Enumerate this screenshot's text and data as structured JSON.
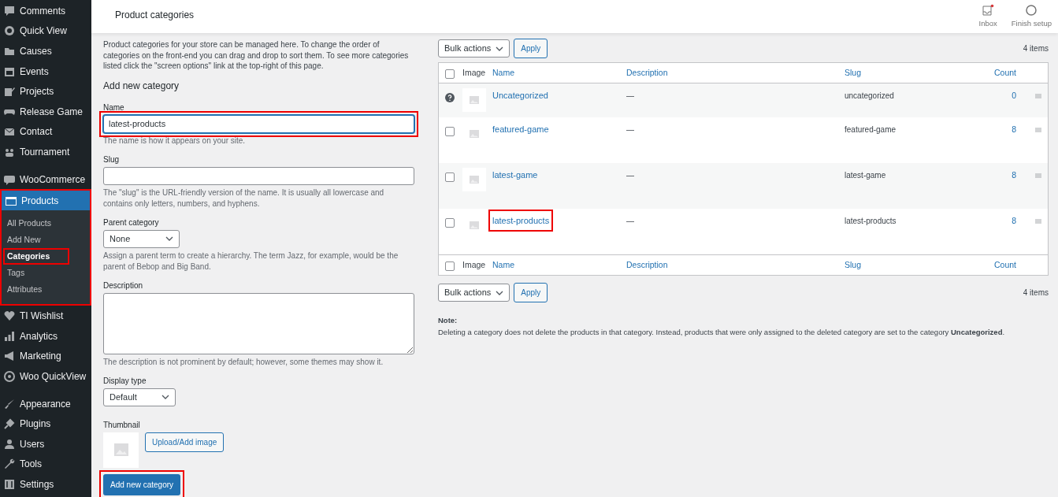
{
  "sidebar": {
    "groups": [
      {
        "items": [
          {
            "label": "Comments",
            "active": false
          },
          {
            "label": "Quick View",
            "active": false
          },
          {
            "label": "Causes",
            "active": false
          },
          {
            "label": "Events",
            "active": false
          },
          {
            "label": "Projects",
            "active": false
          },
          {
            "label": "Release Game",
            "active": false
          },
          {
            "label": "Contact",
            "active": false
          },
          {
            "label": "Tournament",
            "active": false
          }
        ]
      },
      {
        "items": [
          {
            "label": "WooCommerce",
            "active": false
          },
          {
            "label": "Products",
            "active": true,
            "highlighted": true,
            "children": [
              {
                "label": "All Products",
                "selected": false,
                "highlighted": false
              },
              {
                "label": "Add New",
                "selected": false,
                "highlighted": false
              },
              {
                "label": "Categories",
                "selected": true,
                "highlighted": true
              },
              {
                "label": "Tags",
                "selected": false,
                "highlighted": false
              },
              {
                "label": "Attributes",
                "selected": false,
                "highlighted": false
              }
            ]
          },
          {
            "label": "TI Wishlist",
            "active": false
          },
          {
            "label": "Analytics",
            "active": false
          },
          {
            "label": "Marketing",
            "active": false
          },
          {
            "label": "Woo QuickView",
            "active": false
          }
        ]
      },
      {
        "items": [
          {
            "label": "Appearance",
            "active": false
          },
          {
            "label": "Plugins",
            "active": false
          },
          {
            "label": "Users",
            "active": false
          },
          {
            "label": "Tools",
            "active": false
          },
          {
            "label": "Settings",
            "active": false
          }
        ]
      }
    ]
  },
  "header": {
    "title": "Product categories",
    "actions": [
      {
        "label": "Inbox",
        "unread": true
      },
      {
        "label": "Finish setup",
        "unread": false
      }
    ]
  },
  "form": {
    "intro": "Product categories for your store can be managed here. To change the order of categories on the front-end you can drag and drop to sort them. To see more categories listed click the \"screen options\" link at the top-right of this page.",
    "heading": "Add new category",
    "name": {
      "label": "Name",
      "value": "latest-products",
      "help": "The name is how it appears on your site.",
      "highlighted": true
    },
    "slug": {
      "label": "Slug",
      "help": "The \"slug\" is the URL-friendly version of the name. It is usually all lowercase and contains only letters, numbers, and hyphens."
    },
    "parent": {
      "label": "Parent category",
      "value": "None",
      "help": "Assign a parent term to create a hierarchy. The term Jazz, for example, would be the parent of Bebop and Big Band."
    },
    "description": {
      "label": "Description",
      "help": "The description is not prominent by default; however, some themes may show it."
    },
    "display_type": {
      "label": "Display type",
      "value": "Default"
    },
    "thumbnail": {
      "label": "Thumbnail",
      "button": "Upload/Add image"
    },
    "submit": {
      "label": "Add new category",
      "highlighted": true
    }
  },
  "table": {
    "bulk_top": {
      "select": "Bulk actions",
      "apply": "Apply",
      "count": "4 items"
    },
    "header": {
      "checked": false,
      "columns": [
        "Image",
        "Name",
        "Description",
        "Slug",
        "Count"
      ]
    },
    "rows": [
      {
        "kind": "default",
        "name": "Uncategorized",
        "description": "—",
        "slug": "uncategorized",
        "count": "0",
        "highlighted": false
      },
      {
        "kind": "checkbox",
        "checked": false,
        "name": "featured-game",
        "description": "—",
        "slug": "featured-game",
        "count": "8",
        "highlighted": false
      },
      {
        "kind": "checkbox",
        "checked": false,
        "name": "latest-game",
        "description": "—",
        "slug": "latest-game",
        "count": "8",
        "highlighted": false
      },
      {
        "kind": "checkbox",
        "checked": false,
        "name": "latest-products",
        "description": "—",
        "slug": "latest-products",
        "count": "8",
        "highlighted": true
      }
    ],
    "footer": {
      "checked": false,
      "columns": [
        "Image",
        "Name",
        "Description",
        "Slug",
        "Count"
      ]
    },
    "bulk_bottom": {
      "select": "Bulk actions",
      "apply": "Apply",
      "count": "4 items"
    },
    "note_title": "Note:",
    "note": "Deleting a category does not delete the products in that category. Instead, products that were only assigned to the deleted category are set to the category **Uncategorized**."
  }
}
